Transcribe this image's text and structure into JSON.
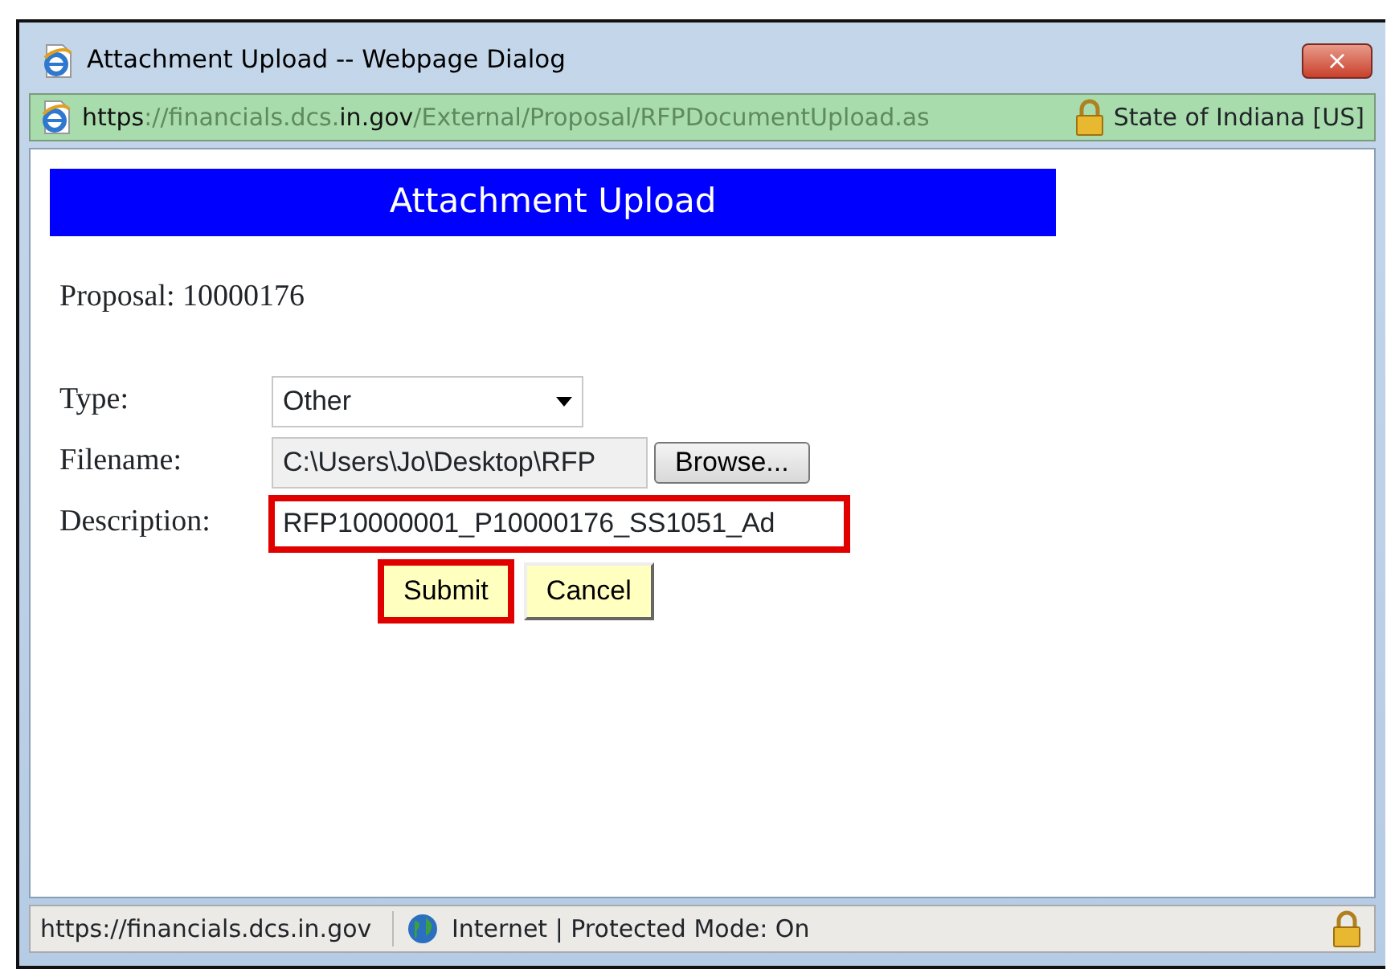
{
  "window": {
    "title": "Attachment Upload -- Webpage Dialog",
    "close": "×"
  },
  "address_bar": {
    "url_parts": [
      {
        "text": "https",
        "emphasized": true
      },
      {
        "text": "://financials.dcs.",
        "emphasized": false
      },
      {
        "text": "in.gov",
        "emphasized": true
      },
      {
        "text": "/External/Proposal/RFPDocumentUpload.as",
        "emphasized": false
      }
    ],
    "certificate": "State of Indiana [US]"
  },
  "page": {
    "heading": "Attachment Upload",
    "proposal": "Proposal: 10000176",
    "fields": [
      {
        "label": "Type:",
        "kind": "select",
        "value": "Other"
      },
      {
        "label": "Filename:",
        "kind": "file",
        "value": "C:\\Users\\Jo\\Desktop\\RFP",
        "button": "Browse..."
      },
      {
        "label": "Description:",
        "kind": "text",
        "value": "RFP10000001_P10000176_SS1051_Ad",
        "highlighted": true
      }
    ],
    "buttons": [
      {
        "label": "Submit",
        "highlighted": true
      },
      {
        "label": "Cancel",
        "highlighted": false
      }
    ]
  },
  "status_bar": {
    "url": "https://financials.dcs.in.gov",
    "zone": "Internet | Protected Mode: On"
  }
}
